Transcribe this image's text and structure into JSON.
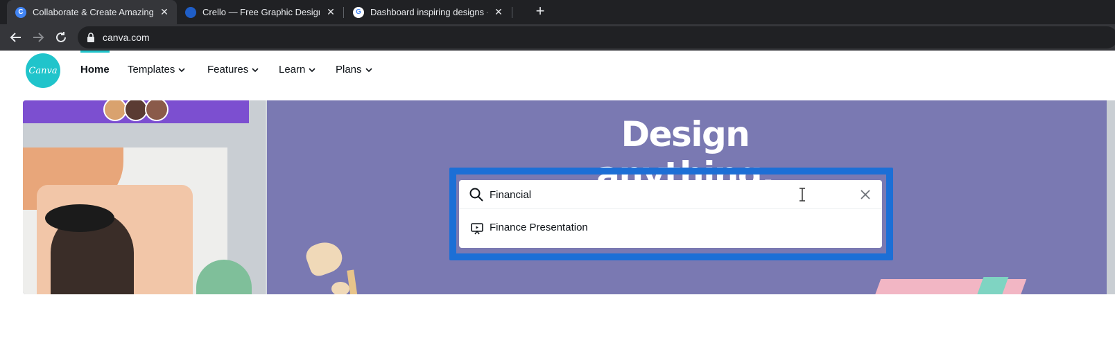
{
  "browser": {
    "tabs": [
      {
        "title": "Collaborate & Create Amazing G",
        "favicon": "C",
        "favicon_color": "#4285f4",
        "active": true
      },
      {
        "title": "Crello — Free Graphic Design So",
        "favicon": "",
        "favicon_color": "#1f5ec7",
        "active": false
      },
      {
        "title": "Dashboard inspiring designs - G",
        "favicon": "G",
        "favicon_color": "#ffffff",
        "active": false
      }
    ],
    "new_tab_label": "+",
    "url": "canva.com"
  },
  "nav": {
    "logo_text": "Canva",
    "items": [
      {
        "label": "Home",
        "active": true
      },
      {
        "label": "Templates"
      },
      {
        "label": "Features"
      },
      {
        "label": "Learn"
      },
      {
        "label": "Plans"
      }
    ]
  },
  "hero": {
    "headline": "Design anything.",
    "search": {
      "value": "Financial",
      "placeholder": ""
    },
    "suggestions": [
      {
        "label": "Finance Presentation",
        "icon": "presentation-icon"
      }
    ]
  },
  "colors": {
    "brand": "#20c4cb",
    "focus": "#1c6fd6",
    "hero_bg": "#7a79b2"
  }
}
